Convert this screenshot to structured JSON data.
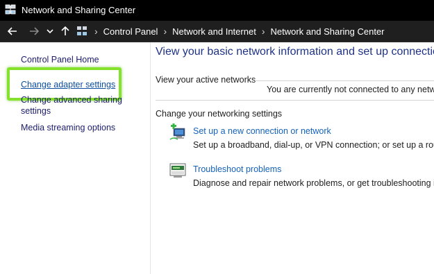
{
  "window": {
    "title": "Network and Sharing Center"
  },
  "address_bar": {
    "breadcrumbs": [
      "Control Panel",
      "Network and Internet",
      "Network and Sharing Center"
    ]
  },
  "left_pane": {
    "links": [
      {
        "label": "Control Panel Home"
      },
      {
        "label": "Change adapter settings"
      },
      {
        "label": "Change advanced sharing"
      },
      {
        "label": "settings"
      },
      {
        "label": "Media streaming options"
      }
    ]
  },
  "main": {
    "heading": "View your basic network information and set up connections",
    "active_networks": {
      "label": "View your active networks",
      "status": "You are currently not connected to any networks."
    },
    "change_settings": {
      "label": "Change your networking settings",
      "tasks": [
        {
          "icon": "new-connection-icon",
          "link": "Set up a new connection or network",
          "description": "Set up a broadband, dial-up, or VPN connection; or set up a router or access point."
        },
        {
          "icon": "troubleshoot-icon",
          "link": "Troubleshoot problems",
          "description": "Diagnose and repair network problems, or get troubleshooting information."
        }
      ]
    }
  },
  "colors": {
    "title_bar": "#000000",
    "address_bar": "#1f1f1f",
    "heading": "#1e3287",
    "link": "#1462b9",
    "highlight": "#84e22d"
  }
}
